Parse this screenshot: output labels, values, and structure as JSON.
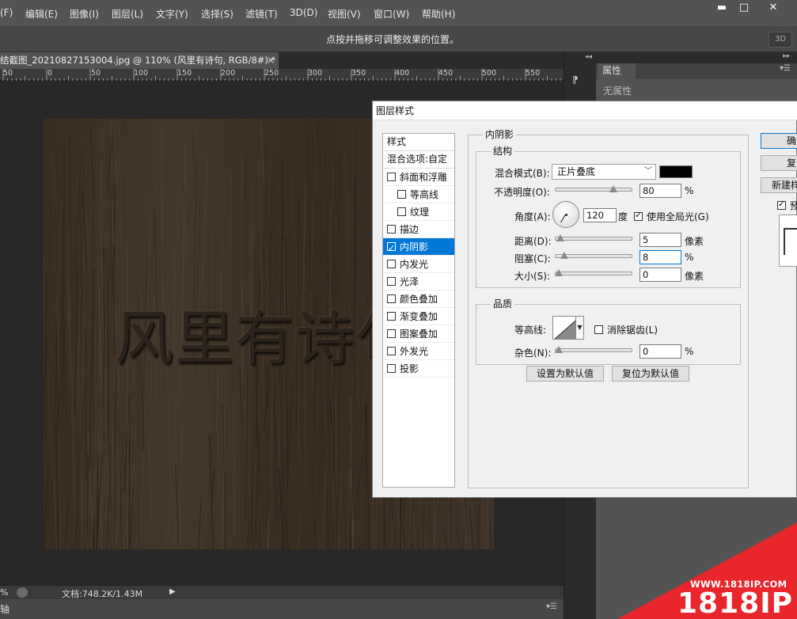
{
  "menubar": {
    "items": [
      "(F)",
      "编辑(E)",
      "图像(I)",
      "图层(L)",
      "文字(Y)",
      "选择(S)",
      "滤镜(T)",
      "3D(D)",
      "视图(V)",
      "窗口(W)",
      "帮助(H)"
    ],
    "minimize": "▬",
    "maximize": "□",
    "close": "✕"
  },
  "optionsbar": {
    "hint": "点按并拖移可调整效果的位置。",
    "btn_3d": "3D"
  },
  "document": {
    "tab_title": "结截图_20210827153004.jpg @ 110% (风里有诗句, RGB/8#) *",
    "tab_close": "×",
    "ruler_labels": [
      "50",
      "0",
      "50",
      "100",
      "150",
      "200",
      "250",
      "300",
      "350",
      "400",
      "450",
      "500",
      "550"
    ],
    "carved_text": "风里有诗句"
  },
  "statusbar": {
    "zoom": "%",
    "doc_size": "文档:748.2K/1.43M",
    "bottom_label": "轴"
  },
  "properties_panel": {
    "tab": "属性",
    "empty_text": "无属性"
  },
  "dialog": {
    "title": "图层样式",
    "styles_header": "样式",
    "blend_options": "混合选项:自定",
    "styles": [
      {
        "label": "斜面和浮雕",
        "checked": false,
        "sub": false
      },
      {
        "label": "等高线",
        "checked": false,
        "sub": true
      },
      {
        "label": "纹理",
        "checked": false,
        "sub": true
      },
      {
        "label": "描边",
        "checked": false,
        "sub": false
      },
      {
        "label": "内阴影",
        "checked": true,
        "sub": false,
        "selected": true
      },
      {
        "label": "内发光",
        "checked": false,
        "sub": false
      },
      {
        "label": "光泽",
        "checked": false,
        "sub": false
      },
      {
        "label": "颜色叠加",
        "checked": false,
        "sub": false
      },
      {
        "label": "渐变叠加",
        "checked": false,
        "sub": false
      },
      {
        "label": "图案叠加",
        "checked": false,
        "sub": false
      },
      {
        "label": "外发光",
        "checked": false,
        "sub": false
      },
      {
        "label": "投影",
        "checked": false,
        "sub": false
      }
    ],
    "section_title": "内阴影",
    "structure": {
      "title": "结构",
      "blend_mode_label": "混合模式(B):",
      "blend_mode_value": "正片叠底",
      "shadow_color": "#000000",
      "opacity_label": "不透明度(O):",
      "opacity_value": "80",
      "opacity_level": 0.8,
      "opacity_unit": "%",
      "angle_label": "角度(A):",
      "angle_value": "120",
      "angle_unit": "度",
      "global_light_label": "使用全局光(G)",
      "global_light_checked": true,
      "distance_label": "距离(D):",
      "distance_value": "5",
      "distance_level": 0.02,
      "distance_unit": "像素",
      "choke_label": "阻塞(C):",
      "choke_value": "8",
      "choke_level": 0.08,
      "choke_unit": "%",
      "size_label": "大小(S):",
      "size_value": "0",
      "size_level": 0,
      "size_unit": "像素"
    },
    "quality": {
      "title": "品质",
      "contour_label": "等高线:",
      "antialias_label": "消除锯齿(L)",
      "antialias_checked": false,
      "noise_label": "杂色(N):",
      "noise_value": "0",
      "noise_level": 0,
      "noise_unit": "%"
    },
    "make_default": "设置为默认值",
    "reset_default": "复位为默认值",
    "btn_ok": "确",
    "btn_cancel": "复",
    "btn_new_style": "新建样",
    "preview_label": "预"
  },
  "watermark": {
    "url": "WWW.1818IP.COM",
    "brand": "1818IP",
    "color": "#e8262b"
  }
}
